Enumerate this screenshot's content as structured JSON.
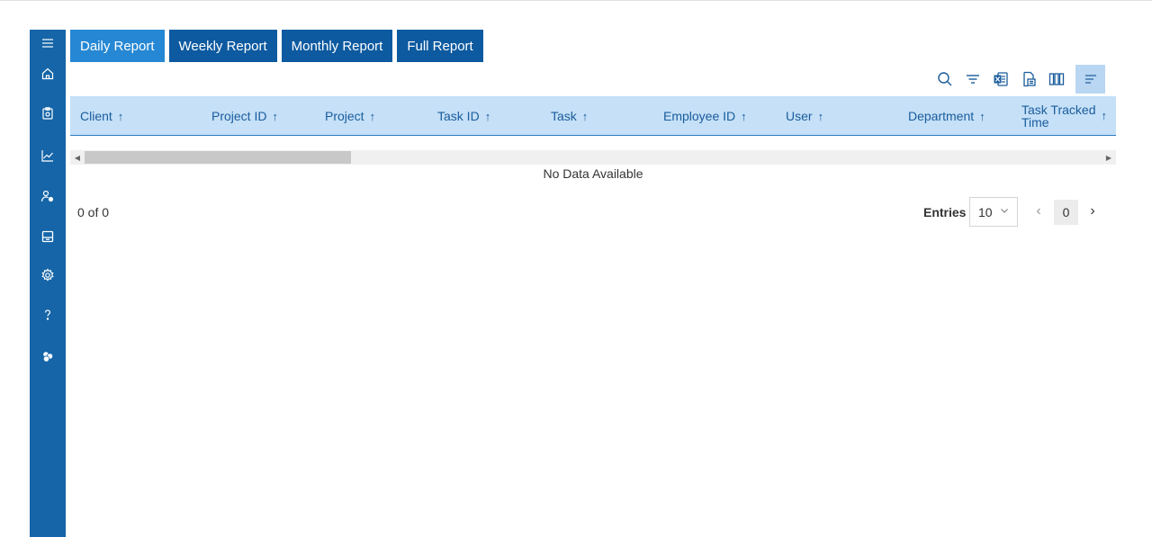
{
  "sidebar": {
    "icons": [
      "menu-icon",
      "home-icon",
      "clipboard-icon",
      "chart-line-icon",
      "user-settings-icon",
      "archive-icon",
      "gear-icon",
      "help-icon",
      "modules-icon"
    ]
  },
  "tabs": [
    {
      "label": "Daily Report",
      "active": true
    },
    {
      "label": "Weekly Report",
      "active": false
    },
    {
      "label": "Monthly Report",
      "active": false
    },
    {
      "label": "Full Report",
      "active": false
    }
  ],
  "toolbar": {
    "icons": [
      "search-icon",
      "filter-icon",
      "excel-export-icon",
      "export-icon",
      "columns-icon",
      "sort-icon"
    ]
  },
  "table": {
    "columns": [
      {
        "label": "Client",
        "sort": "↑"
      },
      {
        "label": "Project ID",
        "sort": "↑"
      },
      {
        "label": "Project",
        "sort": "↑"
      },
      {
        "label": "Task ID",
        "sort": "↑"
      },
      {
        "label": "Task",
        "sort": "↑"
      },
      {
        "label": "Employee ID",
        "sort": "↑"
      },
      {
        "label": "User",
        "sort": "↑"
      },
      {
        "label": "Department",
        "sort": "↑"
      },
      {
        "label": "Task Tracked Time",
        "line1": "Task Tracked",
        "line2": "Time",
        "sort": "↑"
      }
    ],
    "empty_text": "No Data Available"
  },
  "pagination": {
    "summary": "0 of 0",
    "entries_label": "Entries",
    "entries_value": "10",
    "current_page": "0",
    "prev_symbol": "‹",
    "next_symbol": "›"
  },
  "colors": {
    "sidebar": "#1565a8",
    "tab": "#0d5aa0",
    "tab_active": "#2688d4",
    "header_bg": "#c5e0f7",
    "header_text": "#1a5c9c"
  }
}
